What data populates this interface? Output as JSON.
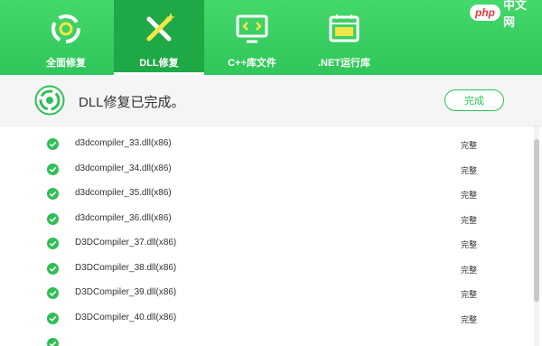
{
  "tabs": [
    {
      "label": "全面修复",
      "icon": "repair-cycle-icon",
      "active": false
    },
    {
      "label": "DLL修复",
      "icon": "tools-cross-icon",
      "active": true
    },
    {
      "label": "C++库文件",
      "icon": "code-monitor-icon",
      "active": false
    },
    {
      "label": ".NET运行库",
      "icon": "dotnet-window-icon",
      "active": false
    }
  ],
  "brand": {
    "php": "php",
    "cn": "中文网"
  },
  "status": {
    "message": "DLL修复已完成。",
    "button_label": "完成"
  },
  "files": [
    {
      "name": "d3dcompiler_33.dll(x86)",
      "state": "完整"
    },
    {
      "name": "d3dcompiler_34.dll(x86)",
      "state": "完整"
    },
    {
      "name": "d3dcompiler_35.dll(x86)",
      "state": "完整"
    },
    {
      "name": "d3dcompiler_36.dll(x86)",
      "state": "完整"
    },
    {
      "name": "D3DCompiler_37.dll(x86)",
      "state": "完整"
    },
    {
      "name": "D3DCompiler_38.dll(x86)",
      "state": "完整"
    },
    {
      "name": "D3DCompiler_39.dll(x86)",
      "state": "完整"
    },
    {
      "name": "D3DCompiler_40.dll(x86)",
      "state": "完整"
    }
  ],
  "colors": {
    "accent": "#2fbf56",
    "topbar": "#3fd366",
    "active_tab": "#1fa846"
  }
}
